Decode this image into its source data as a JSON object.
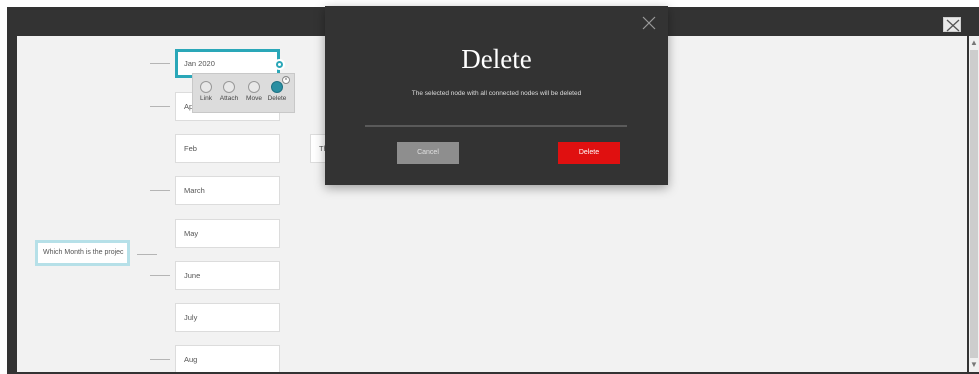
{
  "mindmap": {
    "root_node": "Which Month is the projec",
    "nodes": [
      "Jan 2020",
      "Apr",
      "Feb",
      "March",
      "May",
      "June",
      "July",
      "Aug"
    ],
    "partial_node": "The"
  },
  "context_menu": {
    "items": [
      "Link",
      "Attach",
      "Move",
      "Delete"
    ]
  },
  "dialog": {
    "title": "Delete",
    "message": "The selected node with all connected nodes will be deleted",
    "cancel_label": "Cancel",
    "delete_label": "Delete"
  },
  "colors": {
    "accent_teal": "#2aa7b8",
    "danger_red": "#e01010",
    "dialog_bg": "#333333"
  }
}
